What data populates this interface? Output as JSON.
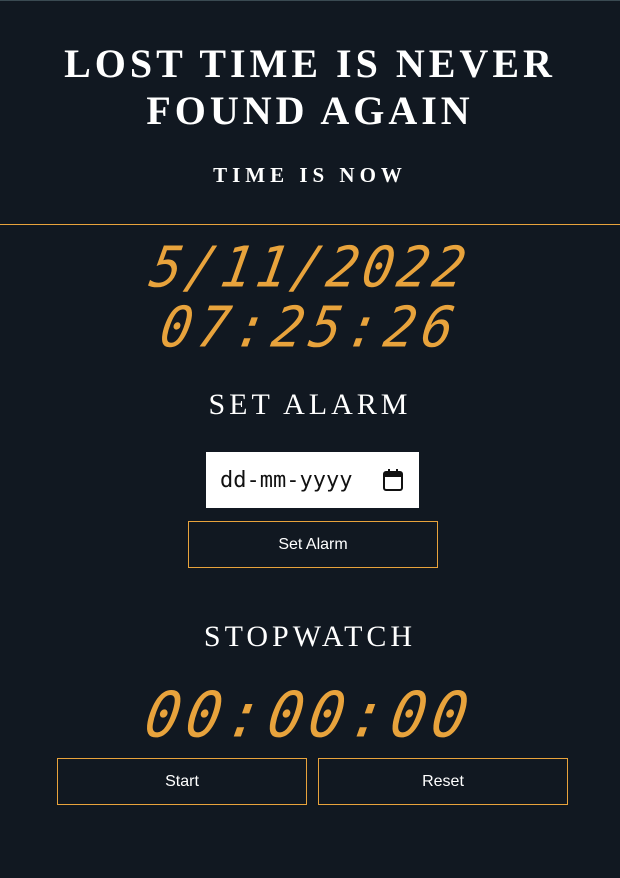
{
  "header": {
    "title": "LOST TIME IS NEVER FOUND AGAIN",
    "subtitle": "TIME IS NOW"
  },
  "clock": {
    "date": "5/11/2022",
    "time": "07:25:26"
  },
  "alarm": {
    "title": "SET ALARM",
    "date_placeholder": "dd-mm-yyyy",
    "button_label": "Set Alarm"
  },
  "stopwatch": {
    "title": "STOPWATCH",
    "readout": "00:00:00",
    "start_label": "Start",
    "reset_label": "Reset"
  },
  "colors": {
    "background": "#111821",
    "accent": "#e8a33c",
    "text": "#ffffff"
  },
  "icons": {
    "calendar": "calendar-icon"
  }
}
